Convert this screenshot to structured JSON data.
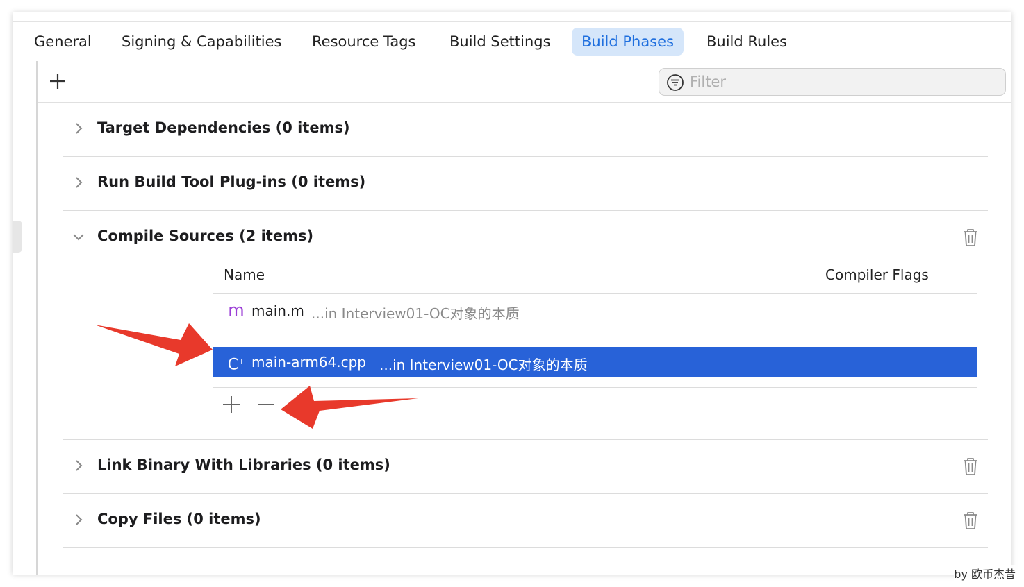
{
  "tabs": [
    {
      "label": "General",
      "active": false
    },
    {
      "label": "Signing & Capabilities",
      "active": false
    },
    {
      "label": "Resource Tags",
      "active": false
    },
    {
      "label": "Build Settings",
      "active": false
    },
    {
      "label": "Build Phases",
      "active": true
    },
    {
      "label": "Build Rules",
      "active": false
    }
  ],
  "toolbar": {
    "filter_placeholder": "Filter"
  },
  "phases": [
    {
      "title": "Target Dependencies (0 items)",
      "expanded": false
    },
    {
      "title": "Run Build Tool Plug-ins (0 items)",
      "expanded": false
    },
    {
      "title": "Compile Sources (2 items)",
      "expanded": true
    },
    {
      "title": "Link Binary With Libraries (0 items)",
      "expanded": false
    },
    {
      "title": "Copy Files (0 items)",
      "expanded": false
    }
  ],
  "compile_sources": {
    "columns": [
      "Name",
      "Compiler Flags"
    ],
    "rows": [
      {
        "icon": "m",
        "name": "main.m",
        "location": "...in Interview01-OC对象的本质",
        "selected": false
      },
      {
        "icon": "C",
        "name": "main-arm64.cpp",
        "location": "...in Interview01-OC对象的本质",
        "selected": true
      }
    ]
  },
  "watermark": "by 欧币杰昔",
  "colors": {
    "accent": "#1f6fde",
    "active_tab_bg": "#d5e6fa",
    "selection": "#2862d8",
    "annotation_arrow": "#e8392b",
    "objc_icon": "#9b3fd6"
  }
}
